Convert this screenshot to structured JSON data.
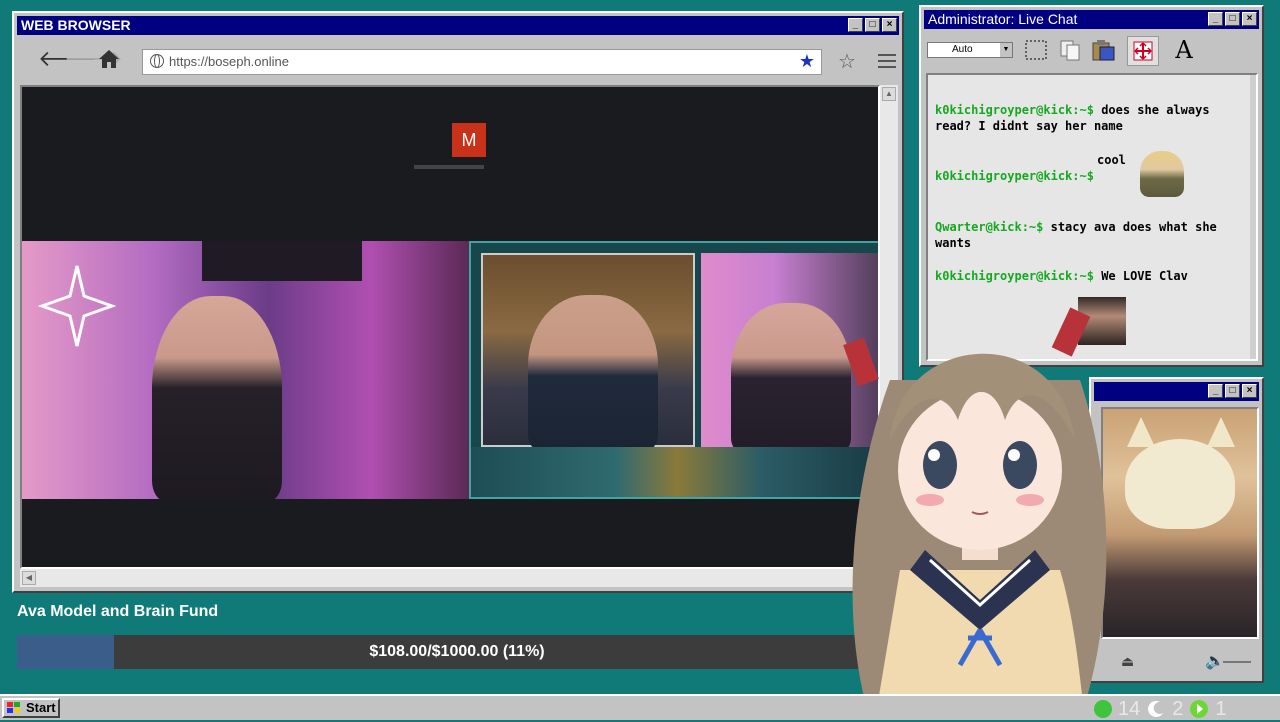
{
  "browser": {
    "title": "WEB BROWSER",
    "url": "https://boseph.online",
    "meeting_avatar_letter": "M"
  },
  "fund": {
    "title": "Ava Model and Brain Fund",
    "raised": 108,
    "goal": 1000,
    "progress_percent": 11,
    "label": "$108.00/$1000.00 (11%)"
  },
  "chat": {
    "title": "Administrator: Live Chat",
    "zoom": "Auto",
    "messages": [
      {
        "user": "k0kichigroyper@kick:~$",
        "text": "does she always read? I didnt say her name"
      },
      {
        "user": "",
        "text": "cool"
      },
      {
        "user": "k0kichigroyper@kick:~$",
        "text": ""
      },
      {
        "user": "Qwarter@kick:~$",
        "text": "stacy ava does what she wants"
      },
      {
        "user": "k0kichigroyper@kick:~$",
        "text": "We LOVE Clav"
      }
    ]
  },
  "taskbar": {
    "start_label": "Start",
    "tray": [
      {
        "icon": "green-status-icon",
        "value": "14",
        "color": "#3ec43e"
      },
      {
        "icon": "moon-icon",
        "value": "2",
        "color": "#ffffff"
      },
      {
        "icon": "play-icon",
        "value": "1",
        "color": "#6fd63a"
      }
    ]
  },
  "colors": {
    "desktop": "#0f7a78",
    "titlebar": "#000080",
    "fund_fill": "#3a5d8a",
    "chat_username": "#16a820"
  }
}
